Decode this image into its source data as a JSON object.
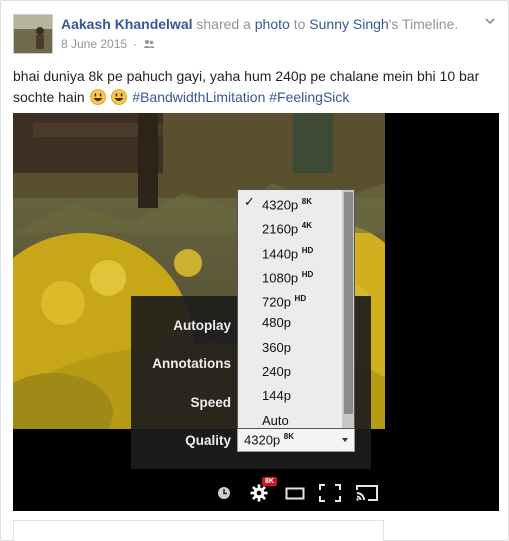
{
  "post": {
    "actor": "Aakash Khandelwal",
    "action": "shared a",
    "object_link": "photo",
    "to_word": "to",
    "target": "Sunny Singh",
    "target_suffix": "'s Timeline.",
    "date": "8 June 2015",
    "audience_icon": "friends-icon",
    "text_line": "bhai duniya 8k pe pahuch gayi, yaha hum 240p pe chalane mein bhi 10 bar sochte hain",
    "hashtags": [
      "#BandwidthLimitation",
      "#FeelingSick"
    ]
  },
  "player": {
    "settings": {
      "autoplay_label": "Autoplay",
      "annotations_label": "Annotations",
      "speed_label": "Speed",
      "quality_label": "Quality",
      "quality_value": "4320p",
      "quality_badge": "8K"
    },
    "quality_options": [
      {
        "label": "4320p",
        "badge": "8K",
        "selected": true
      },
      {
        "label": "2160p",
        "badge": "4K",
        "selected": false
      },
      {
        "label": "1440p",
        "badge": "HD",
        "selected": false
      },
      {
        "label": "1080p",
        "badge": "HD",
        "selected": false
      },
      {
        "label": "720p",
        "badge": "HD",
        "selected": false
      },
      {
        "label": "480p",
        "badge": "",
        "selected": false
      },
      {
        "label": "360p",
        "badge": "",
        "selected": false
      },
      {
        "label": "240p",
        "badge": "",
        "selected": false
      },
      {
        "label": "144p",
        "badge": "",
        "selected": false
      },
      {
        "label": "Auto",
        "badge": "",
        "selected": false
      }
    ],
    "settings_badge": "8K",
    "controls": [
      "watch-later-icon",
      "settings-gear-icon",
      "theater-mode-icon",
      "fullscreen-icon",
      "cast-icon"
    ]
  },
  "colors": {
    "link": "#365899",
    "meta": "#90949c",
    "badge_red": "#cc181e"
  }
}
